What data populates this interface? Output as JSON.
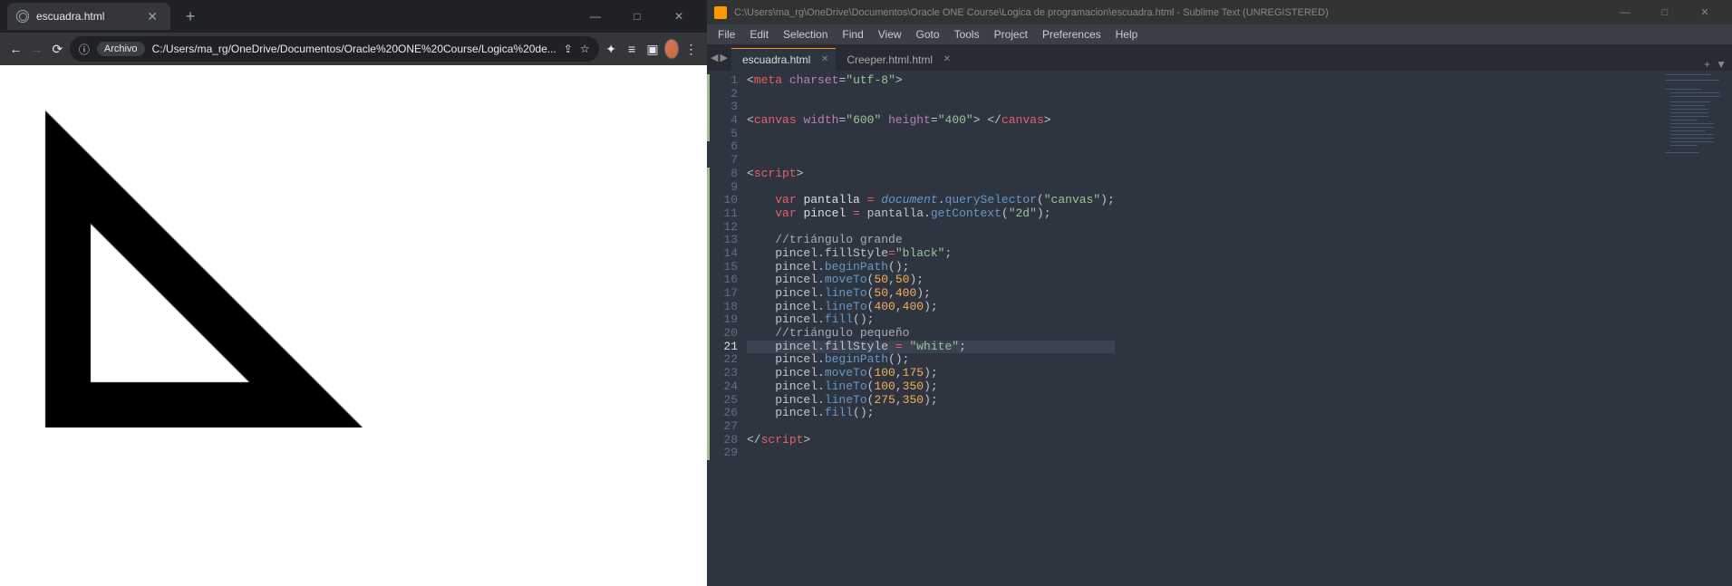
{
  "browser": {
    "tab_title": "escuadra.html",
    "newtab_symbol": "+",
    "nav": {
      "back": "←",
      "forward": "→",
      "reload": "⟳"
    },
    "addr_icon": "ⓘ",
    "addr_pill_label": "Archivo",
    "addr_url": "C:/Users/ma_rg/OneDrive/Documentos/Oracle%20ONE%20Course/Logica%20de...",
    "share": "⇪",
    "star": "☆",
    "ext": "✦",
    "list": "≡",
    "reader": "▣",
    "menu": "⋮",
    "win": {
      "min": "—",
      "max": "□",
      "close": "✕"
    }
  },
  "sublime": {
    "title": "C:\\Users\\ma_rg\\OneDrive\\Documentos\\Oracle ONE Course\\Logica de programacion\\escuadra.html - Sublime Text (UNREGISTERED)",
    "menu": [
      "File",
      "Edit",
      "Selection",
      "Find",
      "View",
      "Goto",
      "Tools",
      "Project",
      "Preferences",
      "Help"
    ],
    "nav": {
      "back": "◀",
      "forward": "▶"
    },
    "tabs": [
      {
        "label": "escuadra.html",
        "active": true
      },
      {
        "label": "Creeper.html.html",
        "active": false
      }
    ],
    "tabbar_end": {
      "plus": "+",
      "dropdown": "▼"
    },
    "win": {
      "min": "—",
      "max": "□",
      "close": "✕"
    }
  },
  "code": {
    "current_line": 21,
    "modified_ranges": [
      [
        1,
        5
      ],
      [
        8,
        29
      ]
    ],
    "lines": [
      {
        "n": 1,
        "seg": [
          [
            "p",
            "<"
          ],
          [
            "t",
            "meta"
          ],
          [
            "p",
            " "
          ],
          [
            "a",
            "charset"
          ],
          [
            "p",
            "="
          ],
          [
            "s",
            "\"utf-8\""
          ],
          [
            "p",
            ">"
          ]
        ]
      },
      {
        "n": 2,
        "seg": []
      },
      {
        "n": 3,
        "seg": []
      },
      {
        "n": 4,
        "seg": [
          [
            "p",
            "<"
          ],
          [
            "t",
            "canvas"
          ],
          [
            "p",
            " "
          ],
          [
            "a",
            "width"
          ],
          [
            "p",
            "="
          ],
          [
            "s",
            "\"600\""
          ],
          [
            "p",
            " "
          ],
          [
            "a",
            "height"
          ],
          [
            "p",
            "="
          ],
          [
            "s",
            "\"400\""
          ],
          [
            "p",
            "> </"
          ],
          [
            "t",
            "canvas"
          ],
          [
            "p",
            ">"
          ]
        ]
      },
      {
        "n": 5,
        "seg": []
      },
      {
        "n": 6,
        "seg": []
      },
      {
        "n": 7,
        "seg": []
      },
      {
        "n": 8,
        "seg": [
          [
            "p",
            "<"
          ],
          [
            "t",
            "script"
          ],
          [
            "p",
            ">"
          ]
        ]
      },
      {
        "n": 9,
        "seg": []
      },
      {
        "n": 10,
        "seg": [
          [
            "p",
            "    "
          ],
          [
            "t",
            "var"
          ],
          [
            "p",
            " "
          ],
          [
            "v",
            "pantalla "
          ],
          [
            "t",
            "="
          ],
          [
            "p",
            " "
          ],
          [
            "i",
            "document"
          ],
          [
            "p",
            "."
          ],
          [
            "f",
            "querySelector"
          ],
          [
            "p",
            "("
          ],
          [
            "s",
            "\"canvas\""
          ],
          [
            "p",
            ");"
          ]
        ]
      },
      {
        "n": 11,
        "seg": [
          [
            "p",
            "    "
          ],
          [
            "t",
            "var"
          ],
          [
            "p",
            " "
          ],
          [
            "v",
            "pincel "
          ],
          [
            "t",
            "="
          ],
          [
            "p",
            " pantalla."
          ],
          [
            "f",
            "getContext"
          ],
          [
            "p",
            "("
          ],
          [
            "s",
            "\"2d\""
          ],
          [
            "p",
            ");"
          ]
        ]
      },
      {
        "n": 12,
        "seg": []
      },
      {
        "n": 13,
        "seg": [
          [
            "p",
            "    "
          ],
          [
            "c",
            "//triángulo grande"
          ]
        ]
      },
      {
        "n": 14,
        "seg": [
          [
            "p",
            "    pincel.fillStyle"
          ],
          [
            "t",
            "="
          ],
          [
            "s",
            "\"black\""
          ],
          [
            "p",
            ";"
          ]
        ]
      },
      {
        "n": 15,
        "seg": [
          [
            "p",
            "    pincel."
          ],
          [
            "f",
            "beginPath"
          ],
          [
            "p",
            "();"
          ]
        ]
      },
      {
        "n": 16,
        "seg": [
          [
            "p",
            "    pincel."
          ],
          [
            "f",
            "moveTo"
          ],
          [
            "p",
            "("
          ],
          [
            "n",
            "50"
          ],
          [
            "p",
            ","
          ],
          [
            "n",
            "50"
          ],
          [
            "p",
            ");"
          ]
        ]
      },
      {
        "n": 17,
        "seg": [
          [
            "p",
            "    pincel."
          ],
          [
            "f",
            "lineTo"
          ],
          [
            "p",
            "("
          ],
          [
            "n",
            "50"
          ],
          [
            "p",
            ","
          ],
          [
            "n",
            "400"
          ],
          [
            "p",
            ");"
          ]
        ]
      },
      {
        "n": 18,
        "seg": [
          [
            "p",
            "    pincel."
          ],
          [
            "f",
            "lineTo"
          ],
          [
            "p",
            "("
          ],
          [
            "n",
            "400"
          ],
          [
            "p",
            ","
          ],
          [
            "n",
            "400"
          ],
          [
            "p",
            ");"
          ]
        ]
      },
      {
        "n": 19,
        "seg": [
          [
            "p",
            "    pincel."
          ],
          [
            "f",
            "fill"
          ],
          [
            "p",
            "();"
          ]
        ]
      },
      {
        "n": 20,
        "seg": [
          [
            "p",
            "    "
          ],
          [
            "c",
            "//triángulo pequeño"
          ]
        ]
      },
      {
        "n": 21,
        "seg": [
          [
            "p",
            "    pincel.fillStyle "
          ],
          [
            "t",
            "="
          ],
          [
            "p",
            " "
          ],
          [
            "s",
            "\"white\""
          ],
          [
            "p",
            ";"
          ]
        ]
      },
      {
        "n": 22,
        "seg": [
          [
            "p",
            "    pincel."
          ],
          [
            "f",
            "beginPath"
          ],
          [
            "p",
            "();"
          ]
        ]
      },
      {
        "n": 23,
        "seg": [
          [
            "p",
            "    pincel."
          ],
          [
            "f",
            "moveTo"
          ],
          [
            "p",
            "("
          ],
          [
            "n",
            "100"
          ],
          [
            "p",
            ","
          ],
          [
            "n",
            "175"
          ],
          [
            "p",
            ");"
          ]
        ]
      },
      {
        "n": 24,
        "seg": [
          [
            "p",
            "    pincel."
          ],
          [
            "f",
            "lineTo"
          ],
          [
            "p",
            "("
          ],
          [
            "n",
            "100"
          ],
          [
            "p",
            ","
          ],
          [
            "n",
            "350"
          ],
          [
            "p",
            ");"
          ]
        ]
      },
      {
        "n": 25,
        "seg": [
          [
            "p",
            "    pincel."
          ],
          [
            "f",
            "lineTo"
          ],
          [
            "p",
            "("
          ],
          [
            "n",
            "275"
          ],
          [
            "p",
            ","
          ],
          [
            "n",
            "350"
          ],
          [
            "p",
            ");"
          ]
        ]
      },
      {
        "n": 26,
        "seg": [
          [
            "p",
            "    pincel."
          ],
          [
            "f",
            "fill"
          ],
          [
            "p",
            "();"
          ]
        ]
      },
      {
        "n": 27,
        "seg": []
      },
      {
        "n": 28,
        "seg": [
          [
            "p",
            "</"
          ],
          [
            "t",
            "script"
          ],
          [
            "p",
            ">"
          ]
        ]
      },
      {
        "n": 29,
        "seg": []
      }
    ]
  }
}
